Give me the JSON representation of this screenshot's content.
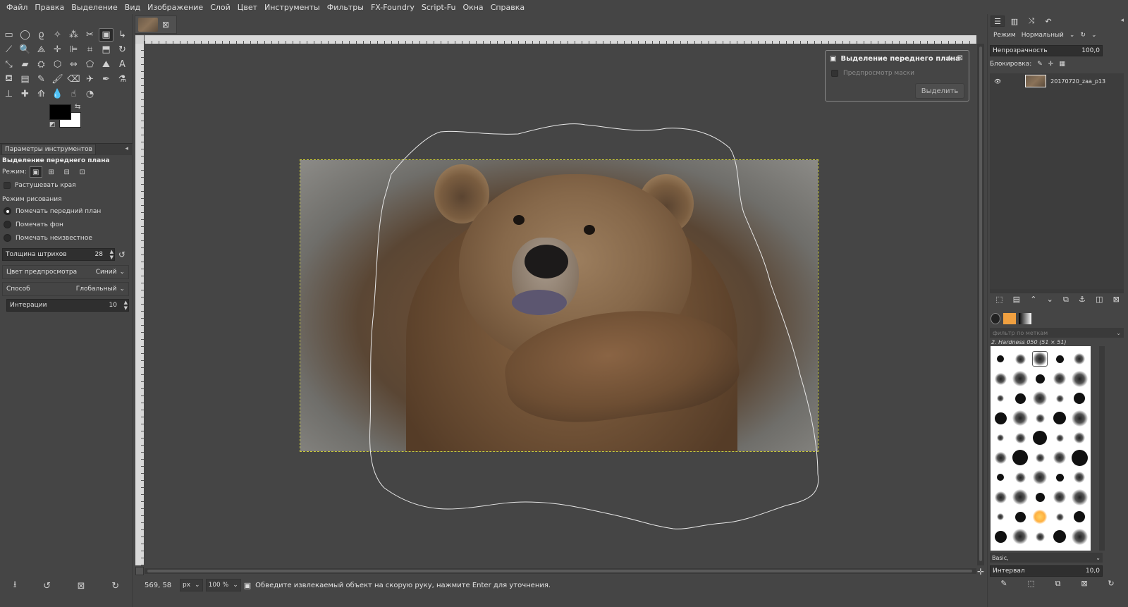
{
  "menu": [
    "Файл",
    "Правка",
    "Выделение",
    "Вид",
    "Изображение",
    "Слой",
    "Цвет",
    "Инструменты",
    "Фильтры",
    "FX-Foundry",
    "Script-Fu",
    "Окна",
    "Справка"
  ],
  "tools": [
    {
      "name": "rect-select-icon",
      "glyph": "▭"
    },
    {
      "name": "ellipse-select-icon",
      "glyph": "◯"
    },
    {
      "name": "lasso-icon",
      "glyph": "ϱ"
    },
    {
      "name": "fuzzy-select-icon",
      "glyph": "✧"
    },
    {
      "name": "select-by-color-icon",
      "glyph": "⁂"
    },
    {
      "name": "scissors-icon",
      "glyph": "✂"
    },
    {
      "name": "foreground-select-icon",
      "glyph": "▣"
    },
    {
      "name": "paths-icon",
      "glyph": "↳"
    },
    {
      "name": "color-picker-icon",
      "glyph": "⟋"
    },
    {
      "name": "zoom-icon",
      "glyph": "🔍"
    },
    {
      "name": "measure-icon",
      "glyph": "⟁"
    },
    {
      "name": "move-icon",
      "glyph": "✛"
    },
    {
      "name": "align-icon",
      "glyph": "⊫"
    },
    {
      "name": "crop-icon",
      "glyph": "⌗"
    },
    {
      "name": "unified-transform-icon",
      "glyph": "⬒"
    },
    {
      "name": "rotate-icon",
      "glyph": "↻"
    },
    {
      "name": "scale-icon",
      "glyph": "⤡"
    },
    {
      "name": "shear-icon",
      "glyph": "▰"
    },
    {
      "name": "warp-icon",
      "glyph": "⛭"
    },
    {
      "name": "perspective-icon",
      "glyph": "⬡"
    },
    {
      "name": "flip-icon",
      "glyph": "⇔"
    },
    {
      "name": "cage-icon",
      "glyph": "⬠"
    },
    {
      "name": "handle-transform-icon",
      "glyph": "⛰"
    },
    {
      "name": "text-icon",
      "glyph": "A"
    },
    {
      "name": "bucket-fill-icon",
      "glyph": "⛾"
    },
    {
      "name": "gradient-icon",
      "glyph": "▤"
    },
    {
      "name": "pencil-icon",
      "glyph": "✎"
    },
    {
      "name": "paintbrush-icon",
      "glyph": "🖌"
    },
    {
      "name": "eraser-icon",
      "glyph": "⌫"
    },
    {
      "name": "airbrush-icon",
      "glyph": "✈"
    },
    {
      "name": "ink-icon",
      "glyph": "✒"
    },
    {
      "name": "mypaint-brush-icon",
      "glyph": "⚗"
    },
    {
      "name": "clone-icon",
      "glyph": "⊥"
    },
    {
      "name": "heal-icon",
      "glyph": "✚"
    },
    {
      "name": "perspective-clone-icon",
      "glyph": "⟰"
    },
    {
      "name": "blur-icon",
      "glyph": "💧"
    },
    {
      "name": "smudge-icon",
      "glyph": "☝"
    },
    {
      "name": "dodge-burn-icon",
      "glyph": "◔"
    }
  ],
  "tool_options": {
    "tab_label": "Параметры инструментов",
    "title": "Выделение переднего плана",
    "mode_label": "Режим:",
    "feather_label": "Растушевать края",
    "draw_mode_label": "Режим рисования",
    "draw_modes": [
      "Помечать передний план",
      "Помечать фон",
      "Помечать неизвестное"
    ],
    "stroke_width_label": "Толщина штрихов",
    "stroke_width_value": "28",
    "preview_color_label": "Цвет предпросмотра",
    "preview_color_value": "Синий",
    "engine_label": "Способ",
    "engine_value": "Глобальный",
    "iterations_label": "Интерации",
    "iterations_value": "10"
  },
  "fg_dialog": {
    "title": "Выделение переднего плана",
    "preview_label": "Предпросмотр маски",
    "select_button": "Выделить"
  },
  "status": {
    "coords": "569, 58",
    "unit": "px",
    "zoom": "100 %",
    "message": "Обведите извлекаемый объект на скорую руку, нажмите Enter для уточнения."
  },
  "layers": {
    "mode_label": "Режим",
    "mode_value": "Нормальный",
    "opacity_label": "Непрозрачность",
    "opacity_value": "100,0",
    "lock_label": "Блокировка:",
    "layer_name": "20170720_zaa_p13"
  },
  "brushes": {
    "filter_placeholder": "фильтр по меткам",
    "current_brush": "2. Hardness 050 (51 × 51)",
    "tag_value": "Basic,",
    "spacing_label": "Интервал",
    "spacing_value": "10,0"
  },
  "colors": {
    "foreground": "#000000",
    "background": "#ffffff",
    "selection_marching_ants": "#c8c83a"
  }
}
